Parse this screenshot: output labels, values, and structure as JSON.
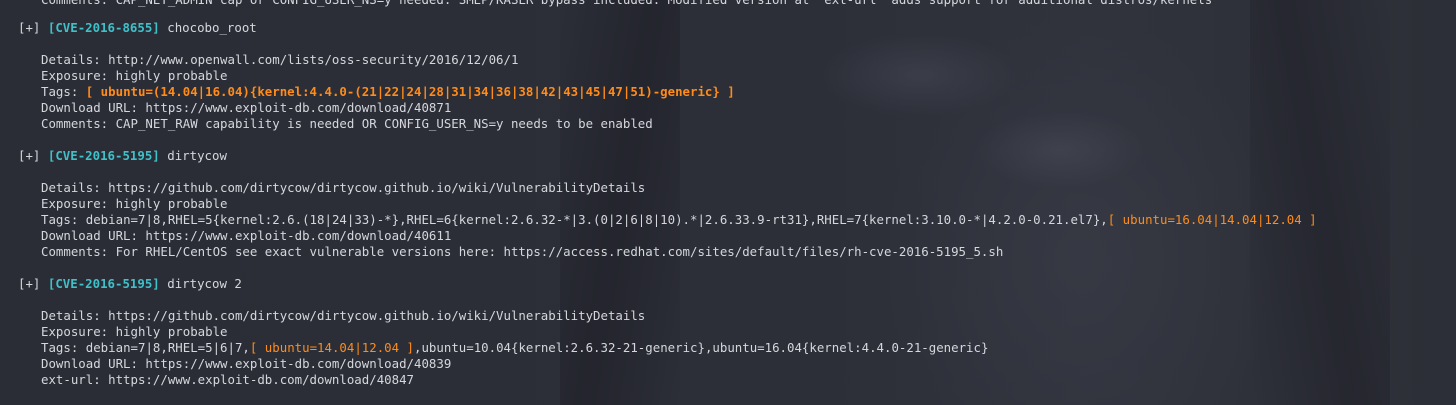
{
  "top_partial_line": "Comments: CAP_NET_ADMIN cap or CONFIG_USER_NS=y needed. SMEP/KASLR bypass included. Modified version at 'ext-url' adds support for additional distros/kernels",
  "entries": [
    {
      "prefix": "[+]",
      "cve": "[CVE-2016-8655]",
      "name": "chocobo_root",
      "details": "Details: http://www.openwall.com/lists/oss-security/2016/12/06/1",
      "exposure": "Exposure: highly probable",
      "tags_label": "Tags: ",
      "tags_pre": "",
      "tags_highlight": "[ ubuntu=(14.04|16.04){kernel:4.4.0-(21|22|24|28|31|34|36|38|42|43|45|47|51)-generic} ]",
      "tags_post": "",
      "download": "Download URL: https://www.exploit-db.com/download/40871",
      "extra": "Comments: CAP_NET_RAW capability is needed OR CONFIG_USER_NS=y needs to be enabled"
    },
    {
      "prefix": "[+]",
      "cve": "[CVE-2016-5195]",
      "name": "dirtycow",
      "details": "Details: https://github.com/dirtycow/dirtycow.github.io/wiki/VulnerabilityDetails",
      "exposure": "Exposure: highly probable",
      "tags_label": "Tags: ",
      "tags_pre": "debian=7|8,RHEL=5{kernel:2.6.(18|24|33)-*},RHEL=6{kernel:2.6.32-*|3.(0|2|6|8|10).*|2.6.33.9-rt31},RHEL=7{kernel:3.10.0-*|4.2.0-0.21.el7},",
      "tags_highlight": "[ ubuntu=16.04|14.04|12.04 ]",
      "tags_post": "",
      "download": "Download URL: https://www.exploit-db.com/download/40611",
      "extra": "Comments: For RHEL/CentOS see exact vulnerable versions here: https://access.redhat.com/sites/default/files/rh-cve-2016-5195_5.sh"
    },
    {
      "prefix": "[+]",
      "cve": "[CVE-2016-5195]",
      "name": "dirtycow 2",
      "details": "Details: https://github.com/dirtycow/dirtycow.github.io/wiki/VulnerabilityDetails",
      "exposure": "Exposure: highly probable",
      "tags_label": "Tags: ",
      "tags_pre": "debian=7|8,RHEL=5|6|7,",
      "tags_highlight": "[ ubuntu=14.04|12.04 ]",
      "tags_post": ",ubuntu=10.04{kernel:2.6.32-21-generic},ubuntu=16.04{kernel:4.4.0-21-generic}",
      "download": "Download URL: https://www.exploit-db.com/download/40839",
      "extra": "ext-url: https://www.exploit-db.com/download/40847"
    }
  ]
}
